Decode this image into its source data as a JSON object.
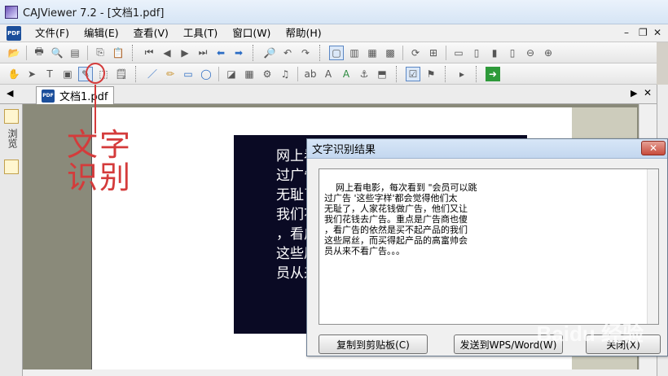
{
  "window": {
    "title": "CAJViewer 7.2 - [文档1.pdf]"
  },
  "menu": {
    "items": [
      "文件(F)",
      "编辑(E)",
      "查看(V)",
      "工具(T)",
      "窗口(W)",
      "帮助(H)"
    ],
    "min_icon": "minimize-icon",
    "restore_icon": "restore-icon",
    "close_icon": "close-icon"
  },
  "tabs": {
    "doc_tab_label": "文档1.pdf"
  },
  "left_panel": {
    "label": "浏览"
  },
  "annotation": {
    "text": "文字识别",
    "color": "#d43b3b"
  },
  "document": {
    "lines": [
      "网上看电影，每",
      "过广告” 这些字",
      "无耻了，人家花",
      "我们花钱去广告",
      "，看广告的依然",
      "这些屌丝，而买",
      "员从来不看广告"
    ]
  },
  "dialog": {
    "title": "文字识别结果",
    "close_label": "✕",
    "result_text": "网上看电影，每次看到 \"会员可以跳\n过广告 '这些字样'都会觉得他们太\n无耻了，人家花钱做广告，他们又让\n我们花钱去广告。重点是广告商也傻\n，看广告的依然是买不起产品的我们\n这些屌丝，而买得起产品的高富帅会\n员从来不看广告。。。",
    "buttons": {
      "copy": "复制到剪贴板(C)",
      "send": "发送到WPS/Word(W)",
      "close": "关闭(X)"
    }
  },
  "watermark": "Baidu 经验"
}
